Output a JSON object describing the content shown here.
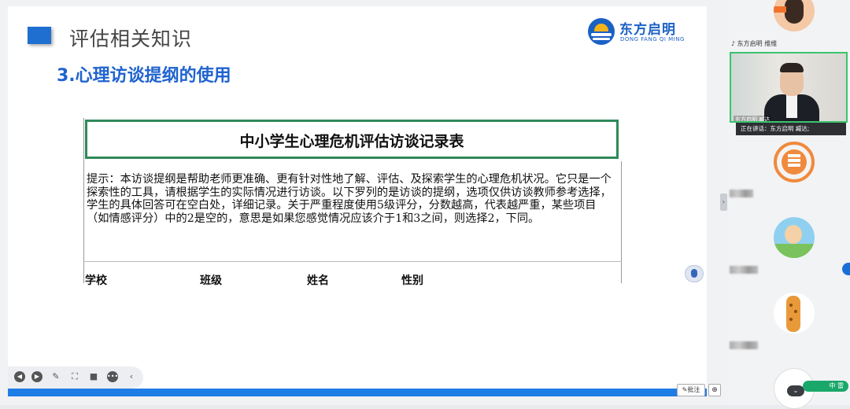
{
  "slide": {
    "title": "评估相关知识",
    "subtitle": "3.心理访谈提纲的使用",
    "logo": {
      "name": "东方启明",
      "sub": "DONG FANG QI MING"
    },
    "document": {
      "title": "中小学生心理危机评估访谈记录表",
      "intro": "提示：本访谈提纲是帮助老师更准确、更有针对性地了解、评估、及探索学生的心理危机状况。它只是一个探索性的工具，请根据学生的实际情况进行访谈。以下罗列的是访谈的提纲，选项仅供访谈教师参考选择，学生的具体回答可在空白处，详细记录。关于严重程度使用5级评分，分数越高，代表越严重，某些项目（如情感评分）中的2是空的，意思是如果您感觉情况应该介于1和3之间，则选择2，下同。",
      "fields": [
        "学校",
        "班级",
        "姓名",
        "性别"
      ]
    }
  },
  "toolbar": {
    "icons": [
      "prev-icon",
      "play-icon",
      "pen-icon",
      "screenshot-icon",
      "camera-icon",
      "more-icon",
      "collapse-left-icon"
    ]
  },
  "bottom": {
    "annotate_label": "批注",
    "zoom_icon": "zoom-icon"
  },
  "panel": {
    "speaker_label": "东方启明 维维",
    "video_name": "东方启明 臧达",
    "speaking_text": "正在讲话：东方启明  臧达;",
    "chat_label": "中 雷"
  },
  "colors": {
    "accent": "#1f63d0",
    "progress": "#1f7de6",
    "doc_border": "#2f8a5a",
    "speaker_border": "#3cc36d"
  }
}
